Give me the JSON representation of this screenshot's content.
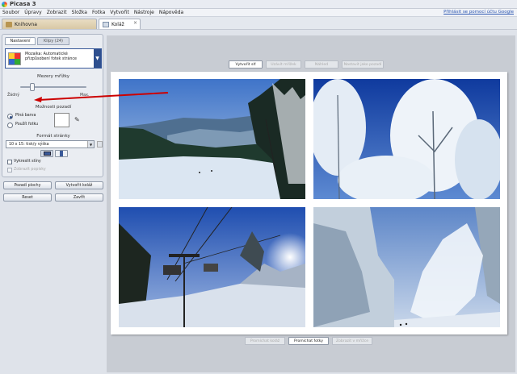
{
  "app": {
    "title": "Picasa 3",
    "help_link": "Přihlásit se pomocí účtu Google"
  },
  "menu": [
    "Soubor",
    "Úpravy",
    "Zobrazit",
    "Složka",
    "Fotka",
    "Vytvořit",
    "Nástroje",
    "Nápověda"
  ],
  "tabs": {
    "library": "Knihovna",
    "collage": "Koláž",
    "close_glyph": "×"
  },
  "panel": {
    "tab_settings": "Nastavení",
    "tab_clips": "Klipy (24)",
    "mosaic_text": "Mozaika: Automatické přizpůsobení fotek stránce",
    "dropdown_glyph": "▼",
    "grid_spacing_label": "Mezery mřížky",
    "slider_min": "Žádný",
    "slider_max": "Max.",
    "slider_value": 0.15,
    "background_label": "Možnosti pozadí",
    "solid_color": "Plná barva",
    "use_photo": "Použít fotku",
    "picker_glyph": "✎",
    "page_format_label": "Formát stránky",
    "page_format_value": "10 x 15: tisk/y výška",
    "draw_borders": "Vykreslit stíny",
    "draw_captions": "Zobrazit popisky",
    "buttons": {
      "clear": "Pozadí plochy",
      "create": "Vytvořit koláž",
      "reset": "Reset",
      "close": "Zavřít"
    }
  },
  "workspace": {
    "top_buttons": [
      "Vytvořit síť",
      "Uzávít mřížek",
      "Náhled",
      "Nastavit jako pozadí"
    ],
    "bottom_buttons": [
      "Promíchat koláž",
      "Promíchat fotky",
      "Zobrazit v mřížce"
    ]
  },
  "photos": [
    {
      "name": "ski-slope-valley"
    },
    {
      "name": "frosted-trees-sky"
    },
    {
      "name": "chairlift-sun"
    },
    {
      "name": "snow-cannon-forest"
    }
  ],
  "colors": {
    "accent": "#2e4f8f",
    "annotation_arrow": "#cc0000"
  }
}
